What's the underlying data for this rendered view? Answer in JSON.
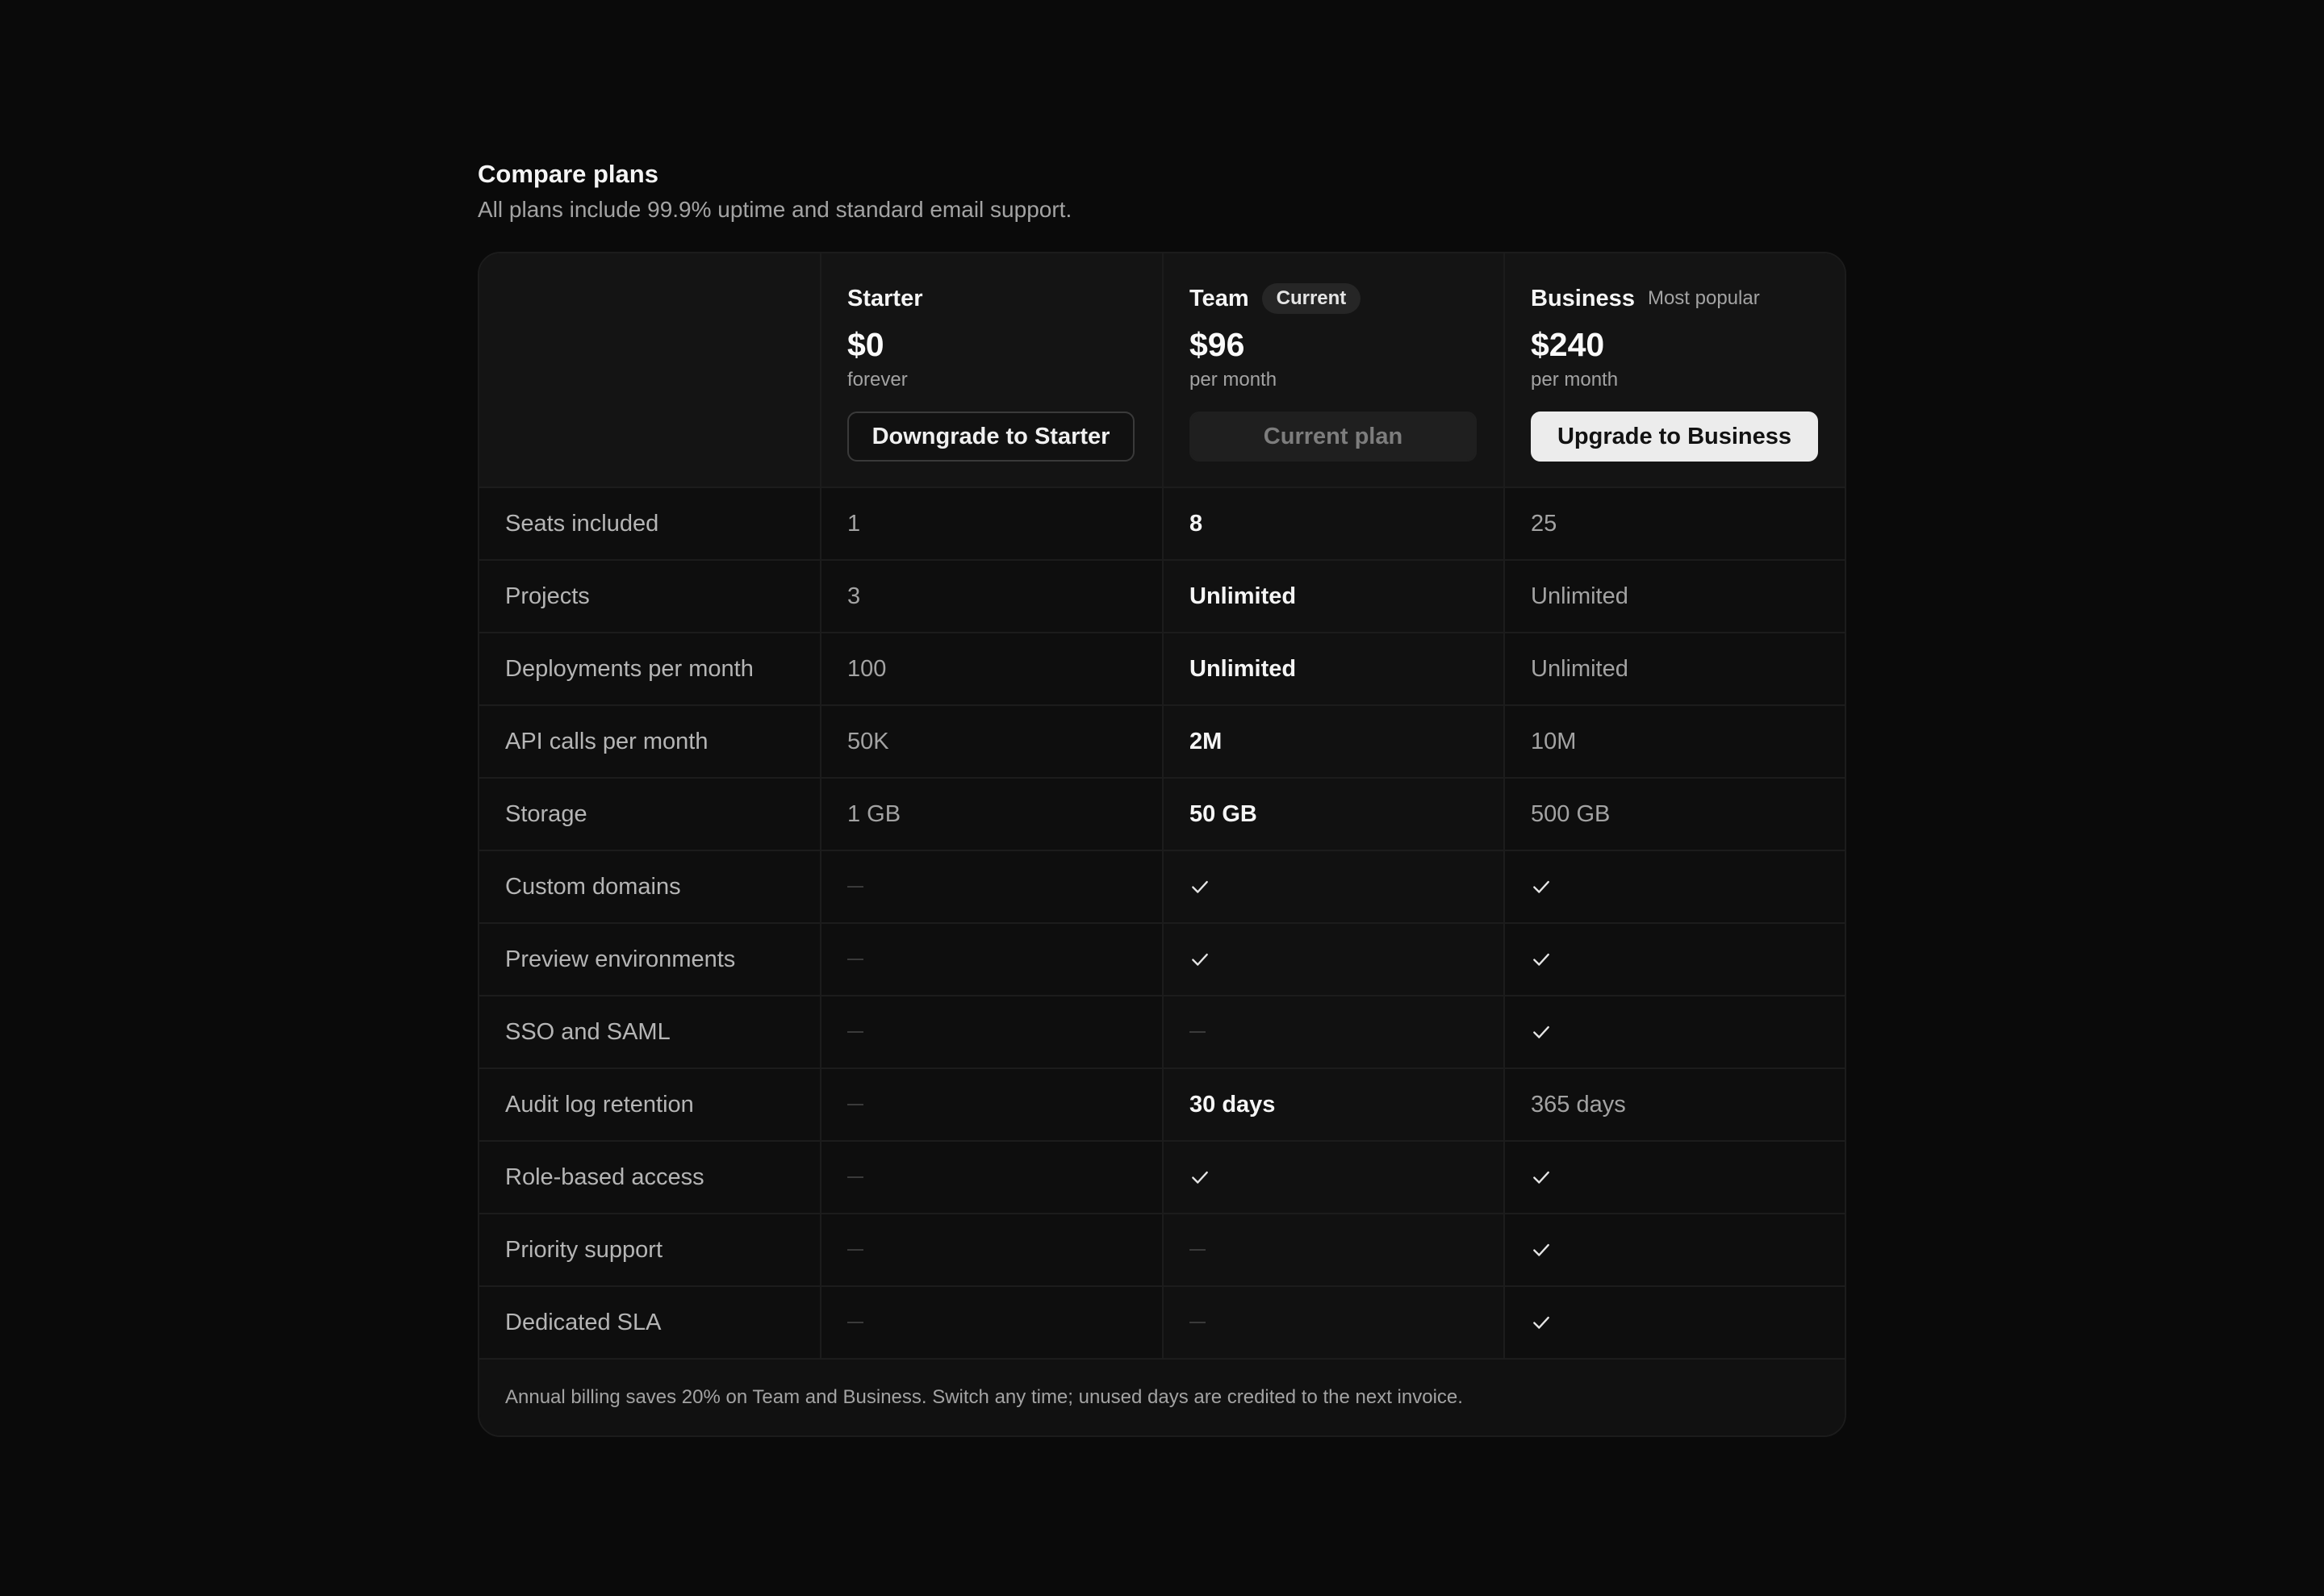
{
  "header": {
    "title": "Compare plans",
    "subtitle": "All plans include 99.9% uptime and standard email support."
  },
  "plans": [
    {
      "name": "Starter",
      "price": "$0",
      "period": "forever",
      "button": "Downgrade to Starter"
    },
    {
      "name": "Team",
      "badge": "Current",
      "price": "$96",
      "period": "per month",
      "button": "Current plan"
    },
    {
      "name": "Business",
      "badge": "Most popular",
      "price": "$240",
      "period": "per month",
      "button": "Upgrade to Business"
    }
  ],
  "rows": [
    {
      "feature": "Seats included",
      "values": [
        "1",
        "8",
        "25"
      ]
    },
    {
      "feature": "Projects",
      "values": [
        "3",
        "Unlimited",
        "Unlimited"
      ]
    },
    {
      "feature": "Deployments per month",
      "values": [
        "100",
        "Unlimited",
        "Unlimited"
      ]
    },
    {
      "feature": "API calls per month",
      "values": [
        "50K",
        "2M",
        "10M"
      ]
    },
    {
      "feature": "Storage",
      "values": [
        "1 GB",
        "50 GB",
        "500 GB"
      ]
    },
    {
      "feature": "Custom domains",
      "values": [
        "dash",
        "check",
        "check"
      ]
    },
    {
      "feature": "Preview environments",
      "values": [
        "dash",
        "check",
        "check"
      ]
    },
    {
      "feature": "SSO and SAML",
      "values": [
        "dash",
        "dash",
        "check"
      ]
    },
    {
      "feature": "Audit log retention",
      "values": [
        "dash",
        "30 days",
        "365 days"
      ]
    },
    {
      "feature": "Role-based access",
      "values": [
        "dash",
        "check",
        "check"
      ]
    },
    {
      "feature": "Priority support",
      "values": [
        "dash",
        "dash",
        "check"
      ]
    },
    {
      "feature": "Dedicated SLA",
      "values": [
        "dash",
        "dash",
        "check"
      ]
    }
  ],
  "footnote": "Annual billing saves 20% on Team and Business. Switch any time; unused days are credited to the next invoice.",
  "colors": {
    "background": "#0a0a0a",
    "card": "#0e0e0e",
    "header": "#141414",
    "current_column": "#111111",
    "border": "#1c1c1c",
    "primary_button": "#ececec"
  }
}
